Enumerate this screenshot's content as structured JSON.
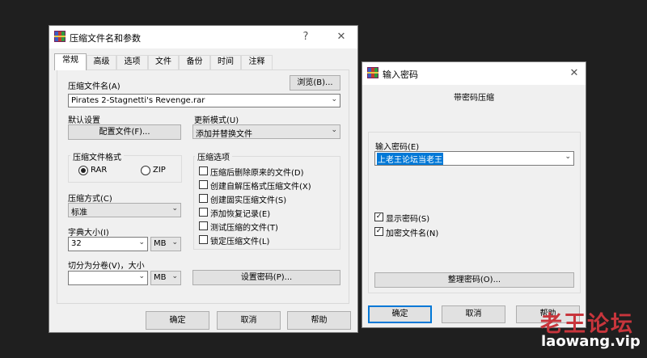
{
  "archive_dialog": {
    "title": "压缩文件名和参数",
    "help_btn": "?",
    "close_btn": "✕",
    "tabs": [
      "常规",
      "高级",
      "选项",
      "文件",
      "备份",
      "时间",
      "注释"
    ],
    "archive_name_label": "压缩文件名(A)",
    "archive_name_value": "Pirates 2-Stagnetti's Revenge.rar",
    "browse_btn": "浏览(B)...",
    "default_settings_label": "默认设置",
    "profiles_btn": "配置文件(F)...",
    "update_mode_label": "更新模式(U)",
    "update_mode_value": "添加并替换文件",
    "format_group_label": "压缩文件格式",
    "format_rar": "RAR",
    "format_zip": "ZIP",
    "options_group_label": "压缩选项",
    "options": [
      {
        "label": "压缩后删除原来的文件(D)",
        "checked": false
      },
      {
        "label": "创建自解压格式压缩文件(X)",
        "checked": false
      },
      {
        "label": "创建固实压缩文件(S)",
        "checked": false
      },
      {
        "label": "添加恢复记录(E)",
        "checked": false
      },
      {
        "label": "测试压缩的文件(T)",
        "checked": false
      },
      {
        "label": "锁定压缩文件(L)",
        "checked": false
      }
    ],
    "method_label": "压缩方式(C)",
    "method_value": "标准",
    "dict_label": "字典大小(I)",
    "dict_value": "32",
    "dict_unit": "MB",
    "split_label": "切分为分卷(V)，大小",
    "split_value": "",
    "split_unit": "MB",
    "set_password_btn": "设置密码(P)...",
    "ok_btn": "确定",
    "cancel_btn": "取消",
    "help_button": "帮助"
  },
  "password_dialog": {
    "title": "输入密码",
    "close_btn": "✕",
    "heading": "带密码压缩",
    "enter_label": "输入密码(E)",
    "password_value": "上老王论坛当老王",
    "show_password": "显示密码(S)",
    "show_password_checked": true,
    "encrypt_names": "加密文件名(N)",
    "encrypt_names_checked": true,
    "organize_btn": "整理密码(O)...",
    "ok_btn": "确定",
    "cancel_btn": "取消",
    "help_btn": "帮助"
  },
  "watermark": {
    "cn": "老王论坛",
    "url": "laowang.vip"
  },
  "colors": {
    "background": "#1f1f1f",
    "dialog": "#f0f0f0",
    "accent": "#0078d7",
    "selection": "#0078d7",
    "watermark_red": "#c8353c"
  }
}
